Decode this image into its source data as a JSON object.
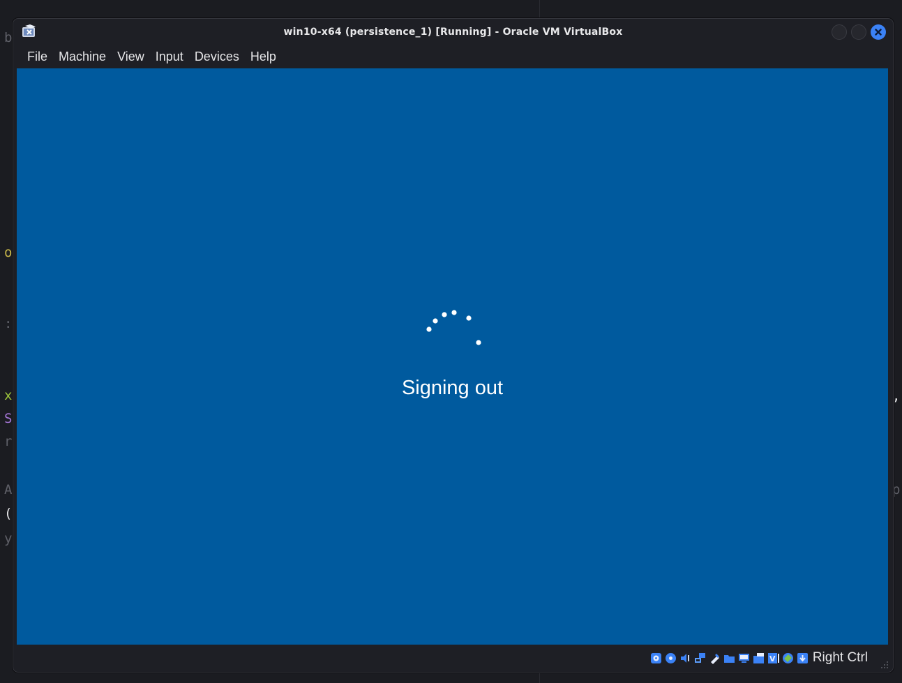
{
  "background_editor": {
    "left_chars": [
      {
        "char": "b",
        "color": "#5f6068"
      },
      {
        "char": "o",
        "color": "#c7b64a"
      },
      {
        "char": ":",
        "color": "#5f6068"
      },
      {
        "char": "x",
        "color": "#9bc23c"
      },
      {
        "char": "S",
        "color": "#a576d6"
      },
      {
        "char": "r",
        "color": "#5f6068"
      },
      {
        "char": "A",
        "color": "#5f6068"
      },
      {
        "char": "(",
        "color": "#e6e6e8"
      },
      {
        "char": "y",
        "color": "#5f6068"
      }
    ],
    "right_chars": [
      {
        "char": ",",
        "color": "#e6e6e8"
      },
      {
        "char": "p",
        "color": "#5f6068"
      }
    ]
  },
  "window": {
    "title": "win10-x64 (persistence_1) [Running] - Oracle VM VirtualBox",
    "app_icon": "virtualbox-icon",
    "controls": [
      "minimize-button",
      "maximize-button",
      "close-button"
    ]
  },
  "menu": {
    "items": [
      "File",
      "Machine",
      "View",
      "Input",
      "Devices",
      "Help"
    ]
  },
  "vm_screen": {
    "background_color": "#005a9e",
    "status_text": "Signing out",
    "spinner_icon": "loading-spinner-icon"
  },
  "statusbar": {
    "icons": [
      "hard-disk-icon",
      "optical-drive-icon",
      "audio-icon",
      "network-icon",
      "usb-icon",
      "shared-folders-icon",
      "display-icon",
      "recording-icon",
      "cpu-icon",
      "mouse-integration-icon",
      "keyboard-icon"
    ],
    "host_key": "Right Ctrl"
  },
  "colors": {
    "accent": "#3b82f6",
    "vm_blue": "#005a9e",
    "chrome": "#1e1f25"
  }
}
